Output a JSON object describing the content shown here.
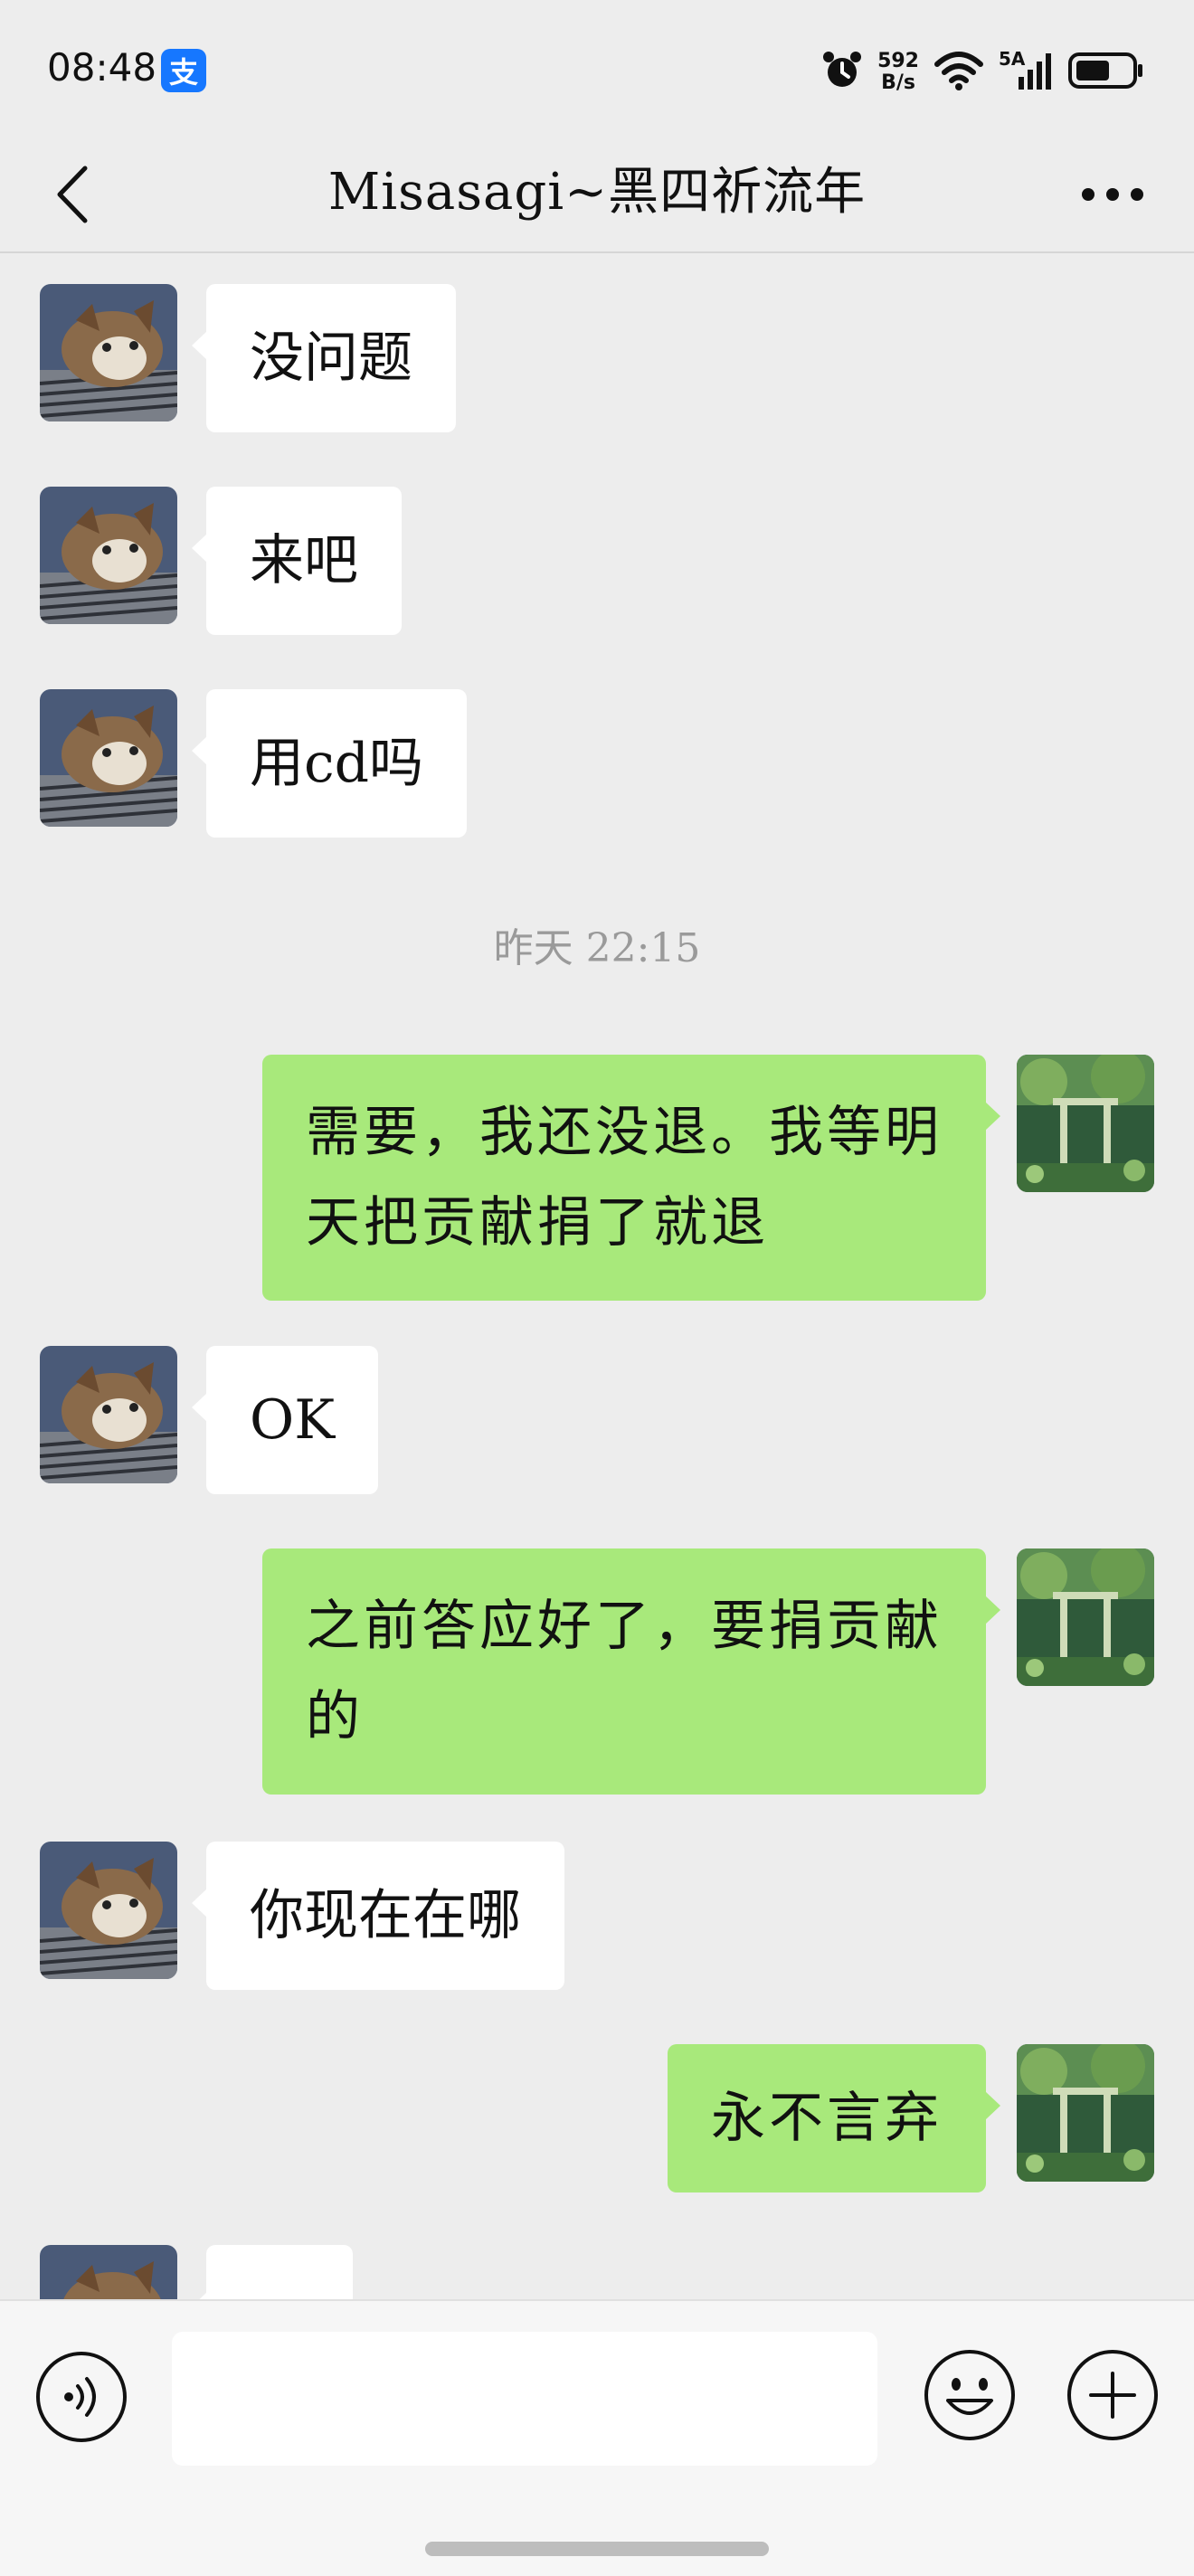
{
  "status_bar": {
    "time": "08:48",
    "app_badge": "支",
    "net_speed_value": "592",
    "net_speed_unit": "B/s",
    "signal_label": "5A",
    "icons": [
      "alarm-icon",
      "wifi-icon",
      "signal-icon",
      "battery-icon"
    ]
  },
  "header": {
    "title": "Misasagi~黑四祈流年",
    "back_icon": "chevron-left-icon",
    "more_icon": "more-icon"
  },
  "messages": [
    {
      "sender": "them",
      "text": "没问题"
    },
    {
      "sender": "them",
      "text": "来吧"
    },
    {
      "sender": "them",
      "text": "用cd吗"
    },
    {
      "type": "time",
      "text": "昨天 22:15"
    },
    {
      "sender": "me",
      "text": "需要，我还没退。我等明天把贡献捐了就退"
    },
    {
      "sender": "them",
      "text": "OK"
    },
    {
      "sender": "me",
      "text": "之前答应好了，要捐贡献的"
    },
    {
      "sender": "them",
      "text": "你现在在哪"
    },
    {
      "sender": "me",
      "text": "永不言弃"
    },
    {
      "sender": "them",
      "text": ""
    }
  ],
  "input_bar": {
    "placeholder": "",
    "icons": [
      "voice-icon",
      "emoji-icon",
      "plus-icon"
    ]
  },
  "colors": {
    "background": "#ededed",
    "outgoing_bubble": "#a8e97b",
    "incoming_bubble": "#ffffff",
    "alipay_badge": "#1677ff"
  }
}
